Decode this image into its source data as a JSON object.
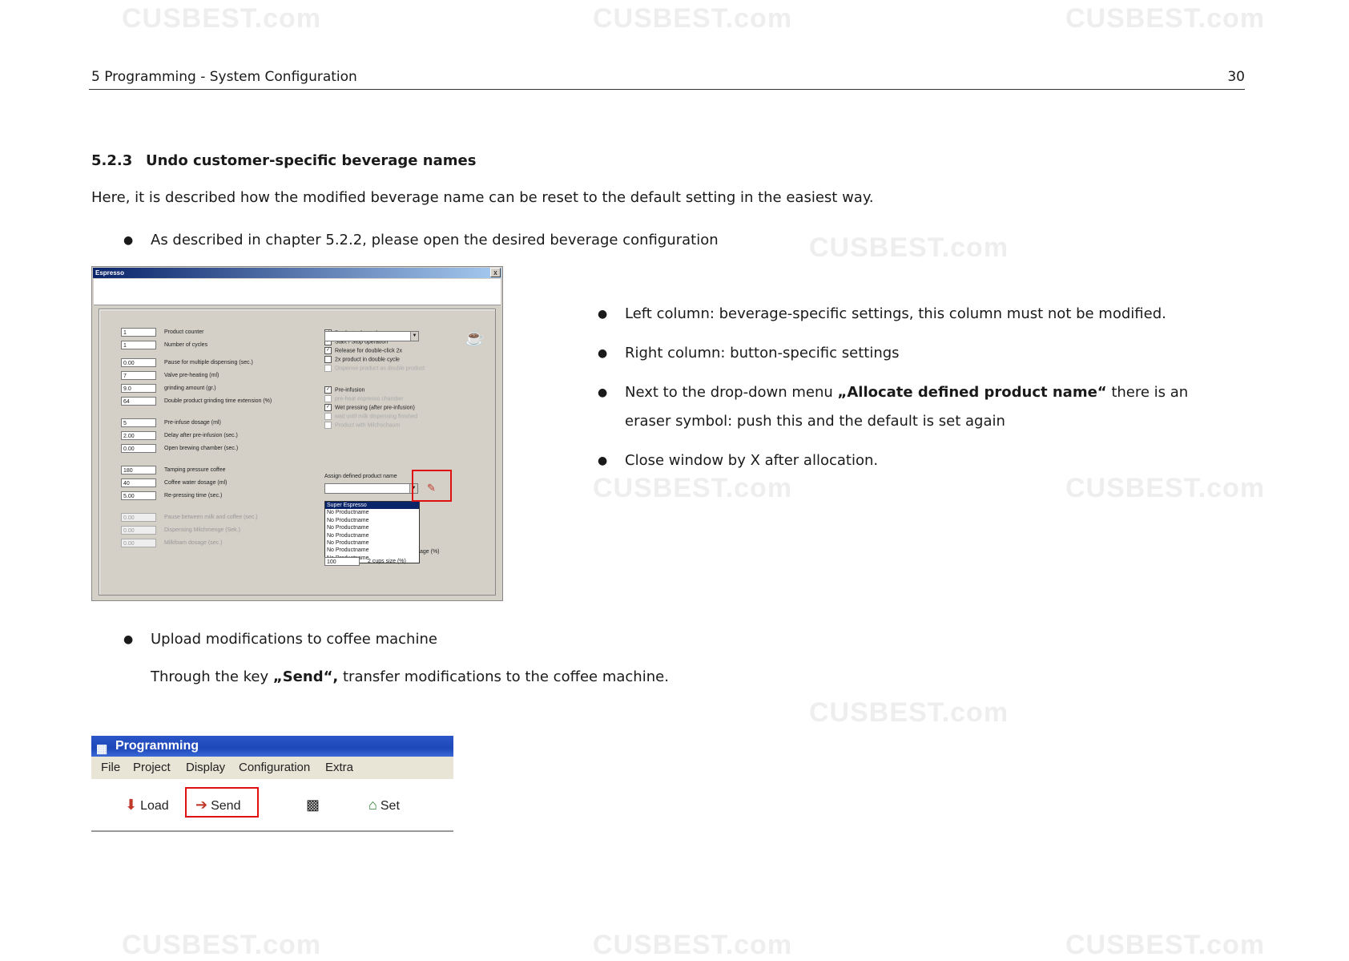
{
  "watermark": "CUSBEST.com",
  "header": {
    "section": "5 Programming - System Configuration",
    "page": "30"
  },
  "heading": {
    "number": "5.2.3",
    "title": "Undo customer-specific beverage names"
  },
  "intro": "Here, it is described how the modified beverage name can be reset to the default setting in the easiest way.",
  "bullet_open": "As described in chapter 5.2.2, please open the desired beverage configuration",
  "bullets_right": [
    "Left column: beverage-specific settings, this column must not be modified.",
    "Right column: button-specific settings"
  ],
  "bullet_eraser": {
    "pre": "Next to the drop-down menu ",
    "bold": "„Allocate defined product name“",
    "post": " there is an",
    "line2": "eraser symbol: push this and the default is set again"
  },
  "bullet_close": "Close window by X after allocation.",
  "bullet_upload": "Upload modifications to coffee machine",
  "send_text": {
    "pre": "Through the key ",
    "bold": "„Send“,",
    "post": " transfer modifications to the coffee machine."
  },
  "espresso_dialog": {
    "title": "Espresso",
    "close": "x",
    "fields": [
      {
        "value": "1",
        "label": "Product counter"
      },
      {
        "value": "1",
        "label": "Number of cycles"
      },
      {
        "value": "0.00",
        "label": "Pause for multiple dispensing (sec.)"
      },
      {
        "value": "7",
        "label": "Valve pre-heating (ml)"
      },
      {
        "value": "9.0",
        "label": "grinding amount (gr.)"
      },
      {
        "value": "64",
        "label": "Double product grinding time extension (%)"
      },
      {
        "value": "5",
        "label": "Pre-infuse dosage (ml)"
      },
      {
        "value": "2.00",
        "label": "Delay after pre-infusion (sec.)"
      },
      {
        "value": "0.00",
        "label": "Open brewing chamber (sec.)"
      },
      {
        "value": "180",
        "label": "Tamping pressure coffee"
      },
      {
        "value": "40",
        "label": "Coffee water dosage (ml)"
      },
      {
        "value": "5.00",
        "label": "Re-pressing time (sec.)"
      },
      {
        "value": "0.00",
        "label": "Pause between milk and coffee (sec.)"
      },
      {
        "value": "0.00",
        "label": "Dispensing Milchmenge (Sek.)"
      },
      {
        "value": "0.00",
        "label": "Milkfoam dosage (sec.)"
      }
    ],
    "checks": [
      {
        "label": "Product released",
        "checked": "✓"
      },
      {
        "label": "Start / Stop operation",
        "checked": "✓"
      },
      {
        "label": "Release for double-click 2x",
        "checked": "✓"
      },
      {
        "label": "2x product in double cycle",
        "checked": ""
      },
      {
        "label": "Dispense product as double product",
        "checked": ""
      },
      {
        "label": "Pre-infusion",
        "checked": "✓"
      },
      {
        "label": "pre-heat espresso chamber",
        "checked": ""
      },
      {
        "label": "Wet pressing (after pre-infusion)",
        "checked": "✓"
      },
      {
        "label": "wait until milk dispensing finished",
        "checked": ""
      },
      {
        "label": "Product with Milchschaum",
        "checked": ""
      }
    ],
    "assign_label": "Assign defined product name",
    "list_items": [
      "Super Espresso",
      "No Productname",
      "No Productname",
      "No Productname",
      "No Productname",
      "No Productname",
      "No Productname",
      "No Productname"
    ],
    "partial_label": "age (%)",
    "cups_value": "100",
    "cups_label": "2 cups size (%)"
  },
  "programming_window": {
    "title": "Programming",
    "menu": [
      "File",
      "Project",
      "Display",
      "Configuration",
      "Extra"
    ],
    "tools": {
      "load": "Load",
      "send": "Send",
      "set": "Set"
    }
  },
  "colors": {
    "highlight": "#e01010",
    "titlebar": "#1e48b9"
  }
}
